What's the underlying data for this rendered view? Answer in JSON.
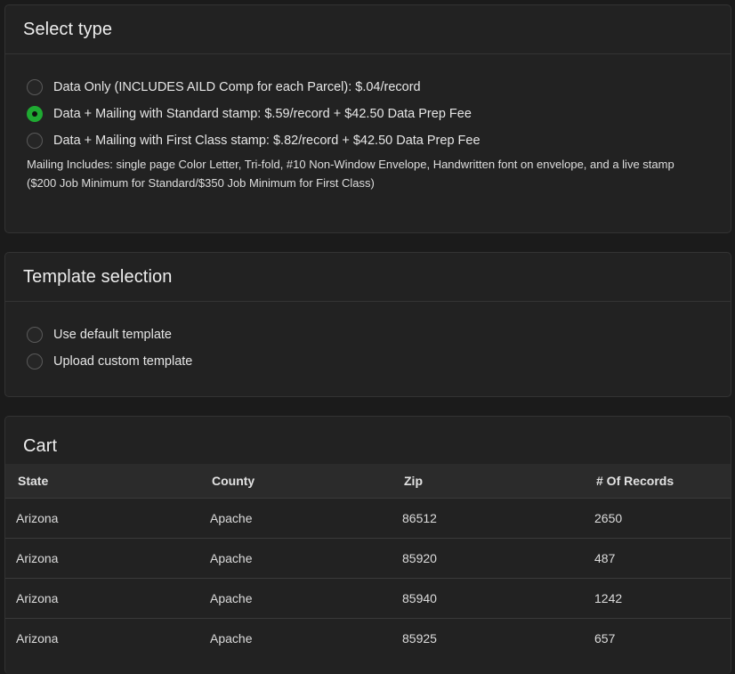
{
  "select_type": {
    "title": "Select type",
    "options": [
      {
        "label": "Data Only (INCLUDES AILD Comp for each Parcel): $.04/record",
        "checked": false
      },
      {
        "label": "Data + Mailing with Standard stamp: $.59/record + $42.50 Data Prep Fee",
        "checked": true
      },
      {
        "label": "Data + Mailing with First Class stamp: $.82/record + $42.50 Data Prep Fee",
        "checked": false
      }
    ],
    "note_line1": "Mailing Includes: single page Color Letter, Tri-fold, #10 Non-Window Envelope, Handwritten font on envelope, and a live stamp",
    "note_line2": "($200 Job Minimum for Standard/$350 Job Minimum for First Class)"
  },
  "template_selection": {
    "title": "Template selection",
    "options": [
      {
        "label": "Use default template",
        "checked": false
      },
      {
        "label": "Upload custom template",
        "checked": false
      }
    ]
  },
  "cart": {
    "title": "Cart",
    "columns": [
      "State",
      "County",
      "Zip",
      "# Of Records"
    ],
    "rows": [
      [
        "Arizona",
        "Apache",
        "86512",
        "2650"
      ],
      [
        "Arizona",
        "Apache",
        "85920",
        "487"
      ],
      [
        "Arizona",
        "Apache",
        "85940",
        "1242"
      ],
      [
        "Arizona",
        "Apache",
        "85925",
        "657"
      ]
    ]
  },
  "colors": {
    "background": "#1b1b1b",
    "card": "#222222",
    "radio_checked": "#1faa32"
  }
}
